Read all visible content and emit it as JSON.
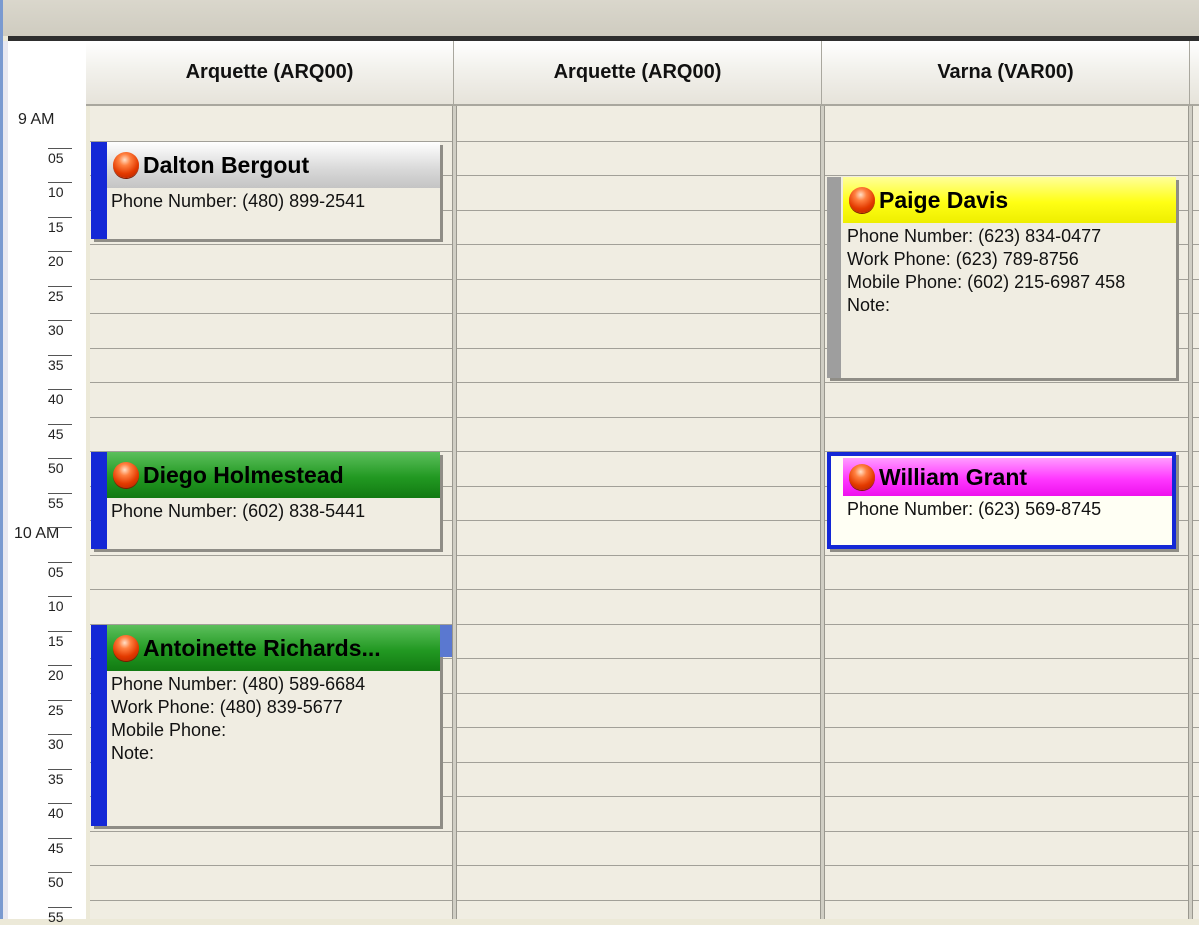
{
  "columns": [
    {
      "label": "Arquette (ARQ00)"
    },
    {
      "label": "Arquette (ARQ00)"
    },
    {
      "label": "Varna (VAR00)"
    }
  ],
  "time_axis": [
    {
      "text": "9 AM",
      "hour": true
    },
    {
      "text": "05"
    },
    {
      "text": "10"
    },
    {
      "text": "15"
    },
    {
      "text": "20"
    },
    {
      "text": "25"
    },
    {
      "text": "30"
    },
    {
      "text": "35"
    },
    {
      "text": "40"
    },
    {
      "text": "45"
    },
    {
      "text": "50"
    },
    {
      "text": "55"
    },
    {
      "text": "10 AM",
      "hour": true
    },
    {
      "text": "05"
    },
    {
      "text": "10"
    },
    {
      "text": "15"
    },
    {
      "text": "20"
    },
    {
      "text": "25"
    },
    {
      "text": "30"
    },
    {
      "text": "35"
    },
    {
      "text": "40"
    },
    {
      "text": "45"
    },
    {
      "text": "50"
    },
    {
      "text": "55"
    }
  ],
  "appointments": [
    {
      "column": 1,
      "name": "Dalton Bergout",
      "title_color": "gray",
      "icon": "status-orb-icon",
      "details": [
        "Phone Number: (480) 899-2541"
      ]
    },
    {
      "column": 1,
      "name": "Diego Holmestead",
      "title_color": "green",
      "icon": "status-orb-icon",
      "details": [
        "Phone Number: (602) 838-5441"
      ]
    },
    {
      "column": 1,
      "name": "Antoinette Richards...",
      "title_color": "green",
      "icon": "status-orb-icon",
      "details": [
        "Phone Number: (480) 589-6684",
        "Work Phone: (480) 839-5677",
        "Mobile Phone:",
        "Note:"
      ]
    },
    {
      "column": 3,
      "name": "Paige Davis",
      "title_color": "yellow",
      "icon": "status-orb-icon",
      "details": [
        "Phone Number: (623) 834-0477",
        "Work Phone: (623) 789-8756",
        "Mobile Phone: (602) 215-6987 458",
        "Note:"
      ]
    },
    {
      "column": 3,
      "name": "William Grant",
      "title_color": "magenta",
      "icon": "status-orb-icon",
      "details": [
        "Phone Number: (623) 569-8745"
      ]
    }
  ],
  "colors": {
    "busy_bar": "#1428d6",
    "grid_bg": "#f0ede2",
    "green_title": "#229922",
    "yellow_title": "#ffff14",
    "magenta_title": "#ff38ff"
  }
}
